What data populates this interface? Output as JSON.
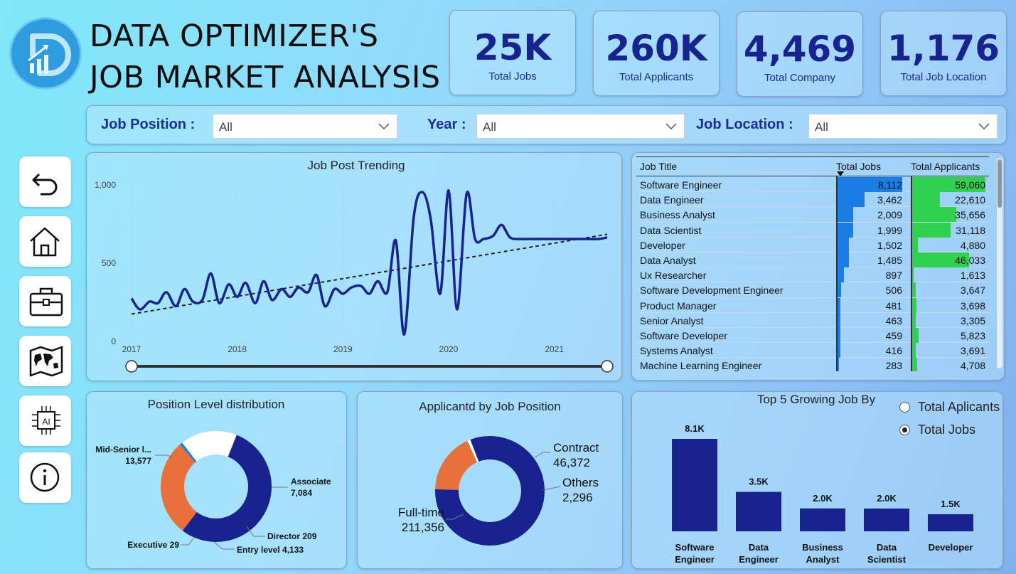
{
  "header": {
    "title_line1": "DATA OPTIMIZER'S",
    "title_line2": "JOB MARKET ANALYSIS"
  },
  "kpis": [
    {
      "value": "25K",
      "label": "Total Jobs"
    },
    {
      "value": "260K",
      "label": "Total Applicants"
    },
    {
      "value": "4,469",
      "label": "Total Company"
    },
    {
      "value": "1,176",
      "label": "Total Job Location"
    }
  ],
  "filters": {
    "job_position": {
      "label": "Job Position :",
      "value": "All"
    },
    "year": {
      "label": "Year :",
      "value": "All"
    },
    "job_location": {
      "label": "Job Location :",
      "value": "All"
    }
  },
  "nav": [
    "back-icon",
    "home-icon",
    "briefcase-icon",
    "map-icon",
    "ai-chip-icon",
    "info-icon"
  ],
  "nav_ai_text": "AI",
  "colors": {
    "navy": "#18238f",
    "orange": "#e8703a",
    "blue_bar": "#1a7de6",
    "green_bar": "#2ed24f"
  },
  "table": {
    "headers": [
      "Job Title",
      "Total Jobs",
      "Total Applicants"
    ],
    "rows": [
      {
        "title": "Software Engineer",
        "jobs": "8,112",
        "applicants": "59,060",
        "jobs_n": 8112,
        "app_n": 59060
      },
      {
        "title": "Data Engineer",
        "jobs": "3,462",
        "applicants": "22,610",
        "jobs_n": 3462,
        "app_n": 22610
      },
      {
        "title": "Business Analyst",
        "jobs": "2,009",
        "applicants": "35,656",
        "jobs_n": 2009,
        "app_n": 35656
      },
      {
        "title": "Data Scientist",
        "jobs": "1,999",
        "applicants": "31,118",
        "jobs_n": 1999,
        "app_n": 31118
      },
      {
        "title": "Developer",
        "jobs": "1,502",
        "applicants": "4,880",
        "jobs_n": 1502,
        "app_n": 4880
      },
      {
        "title": "Data Analyst",
        "jobs": "1,485",
        "applicants": "46,033",
        "jobs_n": 1485,
        "app_n": 46033
      },
      {
        "title": "Ux Researcher",
        "jobs": "897",
        "applicants": "1,613",
        "jobs_n": 897,
        "app_n": 1613
      },
      {
        "title": "Software Development Engineer",
        "jobs": "506",
        "applicants": "3,647",
        "jobs_n": 506,
        "app_n": 3647
      },
      {
        "title": "Product Manager",
        "jobs": "481",
        "applicants": "3,698",
        "jobs_n": 481,
        "app_n": 3698
      },
      {
        "title": "Senior Analyst",
        "jobs": "463",
        "applicants": "3,305",
        "jobs_n": 463,
        "app_n": 3305
      },
      {
        "title": "Software Developer",
        "jobs": "459",
        "applicants": "5,823",
        "jobs_n": 459,
        "app_n": 5823
      },
      {
        "title": "Systems Analyst",
        "jobs": "416",
        "applicants": "3,691",
        "jobs_n": 416,
        "app_n": 3691
      },
      {
        "title": "Machine Learning Engineer",
        "jobs": "283",
        "applicants": "4,708",
        "jobs_n": 283,
        "app_n": 4708
      }
    ]
  },
  "radio": {
    "title": "Top 5 Growing Job By",
    "options": [
      {
        "label": "Total Aplicants",
        "selected": false
      },
      {
        "label": "Total Jobs",
        "selected": true
      }
    ]
  },
  "chart_data": [
    {
      "type": "line",
      "title": "Job Post Trending",
      "xlabel": "",
      "ylabel": "",
      "ylim": [
        0,
        1000
      ],
      "yticks": [
        "0",
        "500",
        "1,000"
      ],
      "xticks": [
        "2017",
        "2018",
        "2019",
        "2020",
        "2021"
      ],
      "xlim": [
        2017,
        2021.5
      ],
      "grid": true,
      "trendline": {
        "start": [
          2017,
          170
        ],
        "end": [
          2021.5,
          680
        ]
      },
      "series": [
        {
          "x": [
            2017.0,
            2017.08,
            2017.17,
            2017.25,
            2017.33,
            2017.42,
            2017.5,
            2017.58,
            2017.67,
            2017.75,
            2017.83,
            2017.92,
            2018.0,
            2018.08,
            2018.17,
            2018.25,
            2018.33,
            2018.42,
            2018.5,
            2018.58,
            2018.67,
            2018.75,
            2018.83,
            2018.92,
            2019.0,
            2019.08,
            2019.17,
            2019.25,
            2019.33,
            2019.42,
            2019.5,
            2019.58,
            2019.67,
            2019.75,
            2019.83,
            2019.92,
            2020.0,
            2020.08,
            2020.17,
            2020.25,
            2020.33,
            2020.42,
            2020.5,
            2020.58,
            2020.67,
            2020.75,
            2020.83,
            2020.92,
            2021.0,
            2021.08,
            2021.17,
            2021.25,
            2021.33,
            2021.42,
            2021.5
          ],
          "values": [
            270,
            200,
            250,
            240,
            310,
            220,
            330,
            250,
            260,
            430,
            240,
            360,
            280,
            370,
            240,
            380,
            260,
            330,
            280,
            340,
            310,
            420,
            220,
            330,
            300,
            340,
            350,
            300,
            380,
            310,
            640,
            40,
            790,
            950,
            780,
            300,
            960,
            200,
            940,
            650,
            650,
            670,
            740,
            660,
            650,
            650,
            650,
            650,
            650,
            650,
            650,
            650,
            650,
            650,
            660
          ]
        }
      ]
    },
    {
      "type": "pie",
      "title": "Position Level distribution",
      "donut": true,
      "slices": [
        {
          "label": "Mid-Senior l...",
          "value": 13577,
          "value_label": "13,577",
          "color": "#18238f"
        },
        {
          "label": "Associate",
          "value": 7084,
          "value_label": "7,084",
          "color": "#e8703a"
        },
        {
          "label": "Director",
          "value": 209,
          "value_label": "209",
          "color": "#1a7de6"
        },
        {
          "label": "Entry level",
          "value": 4133,
          "value_label": "4,133",
          "color": "#ffffff"
        },
        {
          "label": "Executive",
          "value": 29,
          "value_label": "29",
          "color": "#7a2a8a"
        }
      ]
    },
    {
      "type": "pie",
      "title": "Applicantd by Job Position",
      "donut": true,
      "slices": [
        {
          "label": "Full-time",
          "value": 211356,
          "value_label": "211,356",
          "color": "#18238f"
        },
        {
          "label": "Contract",
          "value": 46372,
          "value_label": "46,372",
          "color": "#e8703a"
        },
        {
          "label": "Others",
          "value": 2296,
          "value_label": "2,296",
          "color": "#ffffff"
        }
      ]
    },
    {
      "type": "bar",
      "title": "Top 5 Growing Job By",
      "categories": [
        "Software Engineer",
        "Data Engineer",
        "Business Analyst",
        "Data Scientist",
        "Developer"
      ],
      "values": [
        8112,
        3462,
        2009,
        1999,
        1502
      ],
      "value_labels": [
        "8.1K",
        "3.5K",
        "2.0K",
        "2.0K",
        "1.5K"
      ],
      "color": "#18238f"
    }
  ]
}
